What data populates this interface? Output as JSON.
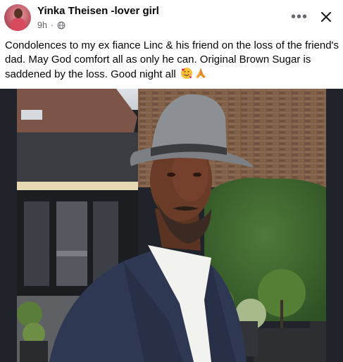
{
  "post": {
    "author_name": "Yinka Theisen -lover girl",
    "timestamp": "9h",
    "privacy_icon": "globe-icon",
    "text": "Condolences to my ex fiance Linc & his friend on the loss of the friend's dad. May God comfort all as only he can. Original Brown Sugar is saddened by the loss. Good night all",
    "emojis": [
      "smiling-face-with-hearts",
      "folded-hands"
    ]
  },
  "actions": {
    "more_icon": "more-options-icon",
    "more_label": "•••",
    "close_icon": "close-icon"
  },
  "colors": {
    "text_primary": "#050505",
    "text_secondary": "#65676b",
    "photo_background": "#20232a"
  }
}
